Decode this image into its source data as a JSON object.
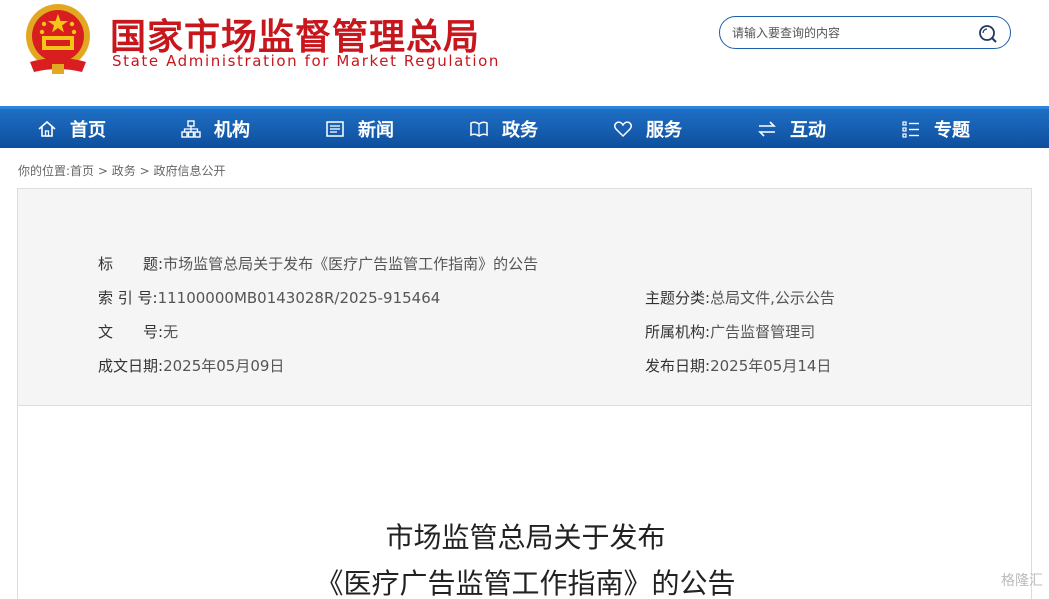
{
  "header": {
    "title_cn": "国家市场监督管理总局",
    "title_en": "State Administration for Market Regulation",
    "emblem_icon": "national-emblem-icon"
  },
  "search": {
    "placeholder": "请输入要查询的内容",
    "icon": "search-icon"
  },
  "nav": {
    "items": [
      {
        "label": "首页",
        "icon": "home-icon"
      },
      {
        "label": "机构",
        "icon": "org-chart-icon"
      },
      {
        "label": "新闻",
        "icon": "news-icon"
      },
      {
        "label": "政务",
        "icon": "book-icon"
      },
      {
        "label": "服务",
        "icon": "heart-icon"
      },
      {
        "label": "互动",
        "icon": "exchange-icon"
      },
      {
        "label": "专题",
        "icon": "list-icon"
      }
    ]
  },
  "breadcrumb": {
    "prefix": "你的位置:",
    "items": [
      "首页",
      "政务",
      "政府信息公开"
    ],
    "separator": " > "
  },
  "meta": {
    "title_label": "标　　题:",
    "title_value": "市场监管总局关于发布《医疗广告监管工作指南》的公告",
    "index_label": "索 引 号:",
    "index_value": "11100000MB0143028R/2025-915464",
    "category_label": "主题分类:",
    "category_value": "总局文件,公示公告",
    "docno_label": "文　　号:",
    "docno_value": "无",
    "org_label": "所属机构:",
    "org_value": "广告监督管理司",
    "written_label": "成文日期:",
    "written_value": "2025年05月09日",
    "published_label": "发布日期:",
    "published_value": "2025年05月14日"
  },
  "article": {
    "title_line1": "市场监管总局关于发布",
    "title_line2": "《医疗广告监管工作指南》的公告"
  },
  "watermark": "格隆汇",
  "colors": {
    "brand_red": "#c8161d",
    "nav_blue": "#1660b4"
  }
}
